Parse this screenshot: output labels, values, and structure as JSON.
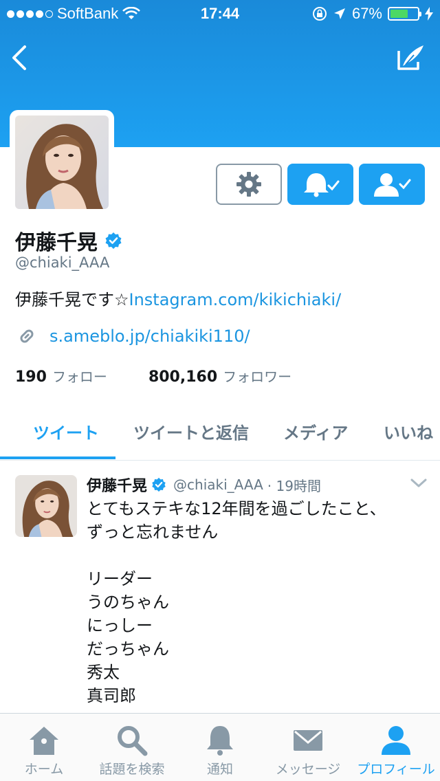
{
  "status_bar": {
    "carrier": "SoftBank",
    "time": "17:44",
    "battery_percent": "67%",
    "battery_level": 0.67,
    "signal_bars_filled": 4,
    "signal_bars_total": 5
  },
  "header": {
    "back_icon": "chevron-left-icon",
    "compose_icon": "compose-tweet-icon"
  },
  "profile": {
    "name": "伊藤千晃",
    "verified": true,
    "handle": "@chiaki_AAA",
    "bio_text": "伊藤千晃です☆",
    "bio_link": "Instagram.com/kikichiaki/",
    "website": "s.ameblo.jp/chiakiki110/",
    "following_count": "190",
    "following_label": "フォロー",
    "followers_count": "800,160",
    "followers_label": "フォロワー"
  },
  "actions": {
    "settings_icon": "gear-icon",
    "notify_icon": "bell-check-icon",
    "following_icon": "user-check-icon"
  },
  "tabs": [
    {
      "label": "ツイート",
      "active": true
    },
    {
      "label": "ツイートと返信",
      "active": false
    },
    {
      "label": "メディア",
      "active": false
    },
    {
      "label": "いいね",
      "active": false
    }
  ],
  "tweet": {
    "name": "伊藤千晃",
    "handle": "@chiaki_AAA",
    "time": "· 19時間",
    "lines": [
      "とてもステキな12年間を過ごしたこと、",
      "ずっと忘れません",
      "",
      "リーダー",
      "うのちゃん",
      "にっしー",
      "だっちゃん",
      "秀太",
      "真司郎"
    ]
  },
  "bottom_nav": [
    {
      "label": "ホーム",
      "icon": "home-icon",
      "active": false
    },
    {
      "label": "話題を検索",
      "icon": "search-icon",
      "active": false
    },
    {
      "label": "通知",
      "icon": "bell-icon",
      "active": false
    },
    {
      "label": "メッセージ",
      "icon": "envelope-icon",
      "active": false
    },
    {
      "label": "プロフィール",
      "icon": "person-icon",
      "active": true
    }
  ],
  "colors": {
    "accent": "#1da1f2",
    "link": "#1b95e0",
    "secondary_text": "#657786",
    "battery": "#4cd964"
  }
}
